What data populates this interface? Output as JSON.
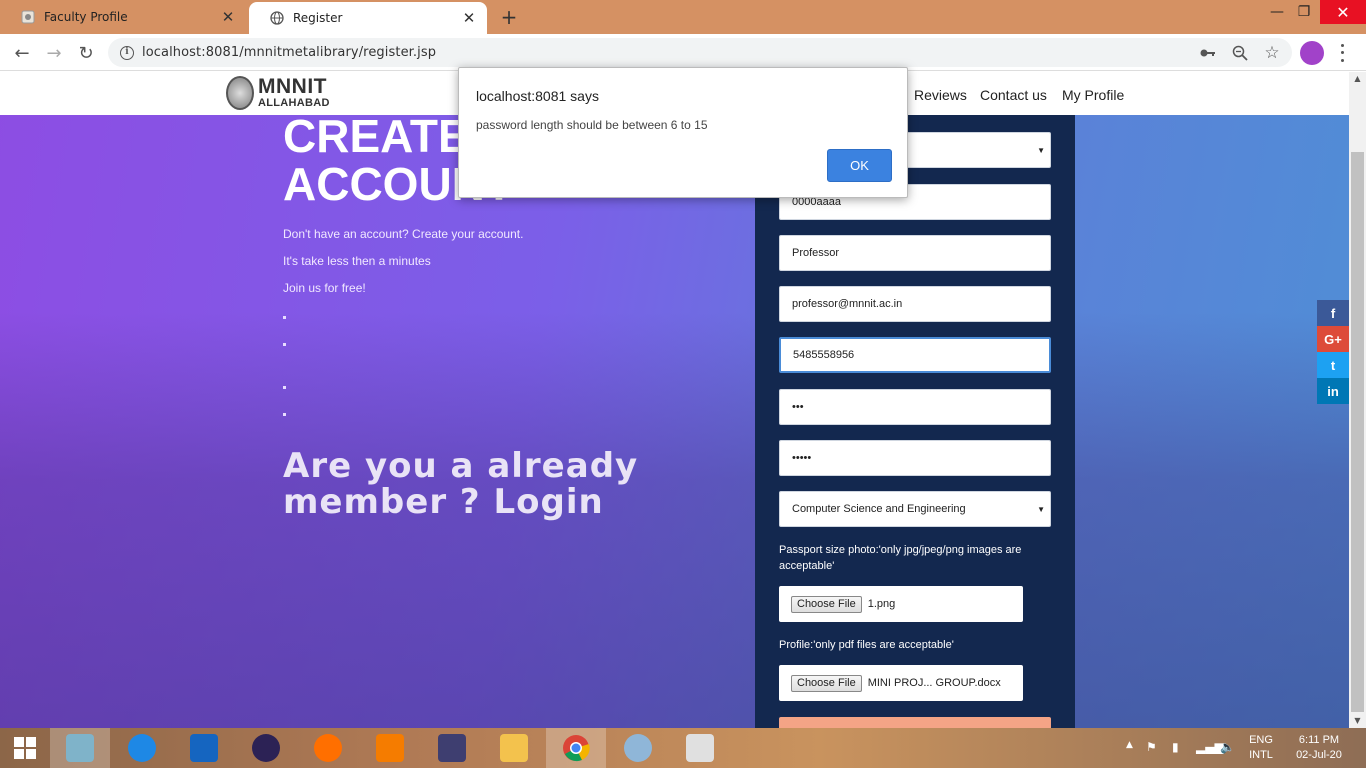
{
  "browser": {
    "tabs": [
      {
        "label": "Faculty Profile",
        "active": false
      },
      {
        "label": "Register",
        "active": true
      }
    ],
    "url": "localhost:8081/mnnitmetalibrary/register.jsp"
  },
  "site": {
    "logo_line1": "MNNIT",
    "logo_line2": "ALLAHABAD",
    "nav": [
      "Reviews",
      "Contact us",
      "My Profile"
    ]
  },
  "hero": {
    "title_line1": "CREATE",
    "title_line2": "ACCOUNT",
    "lines": [
      "Don't have an account? Create your account.",
      "It's take less then a minutes",
      "Join us for free!"
    ],
    "login_line1": "Are you a already",
    "login_line2": "member ? Login"
  },
  "form": {
    "userid": "0000aaaa",
    "designation": "Professor",
    "email": "professor@mnnit.ac.in",
    "phone": "5485558956",
    "password": "•••",
    "confirm_password": "•••••",
    "department": "Computer Science and Engineering",
    "photo_hint": "Passport size photo:'only jpg/jpeg/png images are acceptable'",
    "photo_button": "Choose File",
    "photo_file": "1.png",
    "profile_hint": "Profile:'only pdf files are acceptable'",
    "profile_button": "Choose File",
    "profile_file": "MINI   PROJ... GROUP.docx"
  },
  "social": [
    {
      "icon": "facebook-icon",
      "glyph": "f",
      "color": "#3b5998"
    },
    {
      "icon": "google-plus-icon",
      "glyph": "G+",
      "color": "#dd4b39"
    },
    {
      "icon": "twitter-icon",
      "glyph": "t",
      "color": "#1da1f2"
    },
    {
      "icon": "linkedin-icon",
      "glyph": "in",
      "color": "#0077b5"
    }
  ],
  "dialog": {
    "title": "localhost:8081 says",
    "message": "password length should be between 6 to 15",
    "ok": "OK"
  },
  "taskbar": {
    "lang_line1": "ENG",
    "lang_line2": "INTL",
    "time": "6:11 PM",
    "date": "02-Jul-20"
  }
}
